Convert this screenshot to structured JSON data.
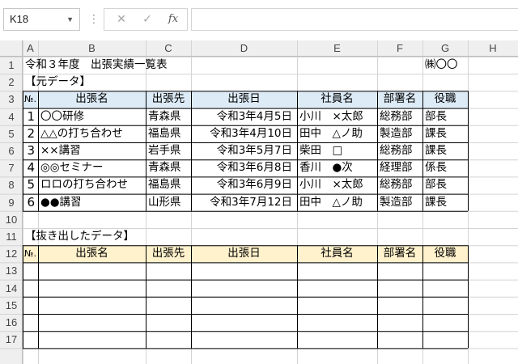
{
  "formula_bar": {
    "name_box": "K18",
    "cancel_icon": "✕",
    "enter_icon": "✓",
    "fx_label": "fx",
    "separator": "⋮",
    "formula": ""
  },
  "columns": [
    "A",
    "B",
    "C",
    "D",
    "E",
    "F",
    "G",
    "H"
  ],
  "rows": [
    "1",
    "2",
    "3",
    "4",
    "5",
    "6",
    "7",
    "8",
    "9",
    "10",
    "11",
    "12",
    "13",
    "14",
    "15",
    "16",
    "17"
  ],
  "sheet": {
    "title": "令和３年度　出張実績一覧表",
    "company": "㈱〇〇",
    "section1_label": "【元データ】",
    "section2_label": "【抜き出したデータ】",
    "headers": [
      "№.",
      "出張名",
      "出張先",
      "出張日",
      "社員名",
      "部署名",
      "役職"
    ],
    "source_rows": [
      [
        "1",
        "〇〇研修",
        "青森県",
        "令和3年4月5日",
        "小川　×太郎",
        "総務部",
        "部長"
      ],
      [
        "2",
        "△△の打ち合わせ",
        "福島県",
        "令和3年4月10日",
        "田中　△ノ助",
        "製造部",
        "課長"
      ],
      [
        "3",
        "××講習",
        "岩手県",
        "令和3年5月7日",
        "柴田　□",
        "総務部",
        "課長"
      ],
      [
        "4",
        "◎◎セミナー",
        "青森県",
        "令和3年6月8日",
        "香川　●次",
        "経理部",
        "係長"
      ],
      [
        "5",
        "ロロの打ち合わせ",
        "福島県",
        "令和3年6月9日",
        "小川　×太郎",
        "総務部",
        "部長"
      ],
      [
        "6",
        "●●講習",
        "山形県",
        "令和3年7月12日",
        "田中　△ノ助",
        "製造部",
        "課長"
      ]
    ]
  },
  "colors": {
    "source_header_fill": "#ddebf7",
    "extract_header_fill": "#fff2cc",
    "header_bg": "#efefef",
    "gridline": "#d4d4d4"
  }
}
